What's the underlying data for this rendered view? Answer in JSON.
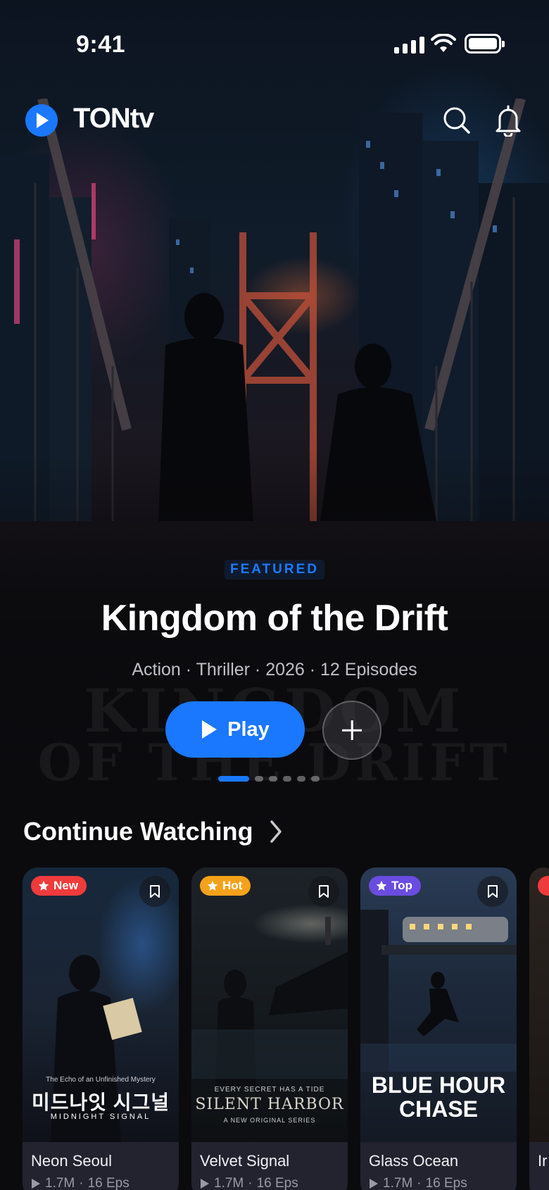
{
  "status_bar": {
    "time": "9:41"
  },
  "header": {
    "brand": "TONtv"
  },
  "hero": {
    "tag": "FEATURED",
    "title": "Kingdom of the Drift",
    "meta": "Action · Thriller · 2026 · 12 Episodes",
    "play_label": "Play",
    "poster_watermark_line1": "KINGDOM",
    "poster_watermark_line2": "OF THE DRIFT",
    "carousel_total": 6,
    "carousel_active": 1
  },
  "continue_watching": {
    "title": "Continue Watching",
    "items": [
      {
        "title": "Neon Seoul",
        "views": "1.7M",
        "episodes": "16 Eps",
        "badge": "New",
        "badge_color": "#ef3b3b",
        "poster_caption": "미드나잇 시그널",
        "poster_sub": "MIDNIGHT SIGNAL",
        "poster_tag": "The Echo of an Unfinished Mystery"
      },
      {
        "title": "Velvet Signal",
        "views": "1.7M",
        "episodes": "16 Eps",
        "badge": "Hot",
        "badge_color": "#f5a21a",
        "poster_caption": "SILENT HARBOR",
        "poster_sub": "A NEW ORIGINAL SERIES",
        "poster_tag": "EVERY SECRET HAS A TIDE"
      },
      {
        "title": "Glass Ocean",
        "views": "1.7M",
        "episodes": "16 Eps",
        "badge": "Top",
        "badge_color": "#6a4ce0",
        "poster_caption": "BLUE HOUR",
        "poster_sub": "CHASE",
        "poster_tag": ""
      },
      {
        "title": "Ir",
        "views": "",
        "episodes": "",
        "badge": "",
        "badge_color": "#ef3b3b",
        "poster_caption": "",
        "poster_sub": "",
        "poster_tag": ""
      }
    ]
  },
  "icons": [
    "play-logo-icon",
    "search-icon",
    "bell-icon",
    "play-icon",
    "plus-icon",
    "chevron-right-icon",
    "star-icon",
    "bookmark-icon"
  ]
}
